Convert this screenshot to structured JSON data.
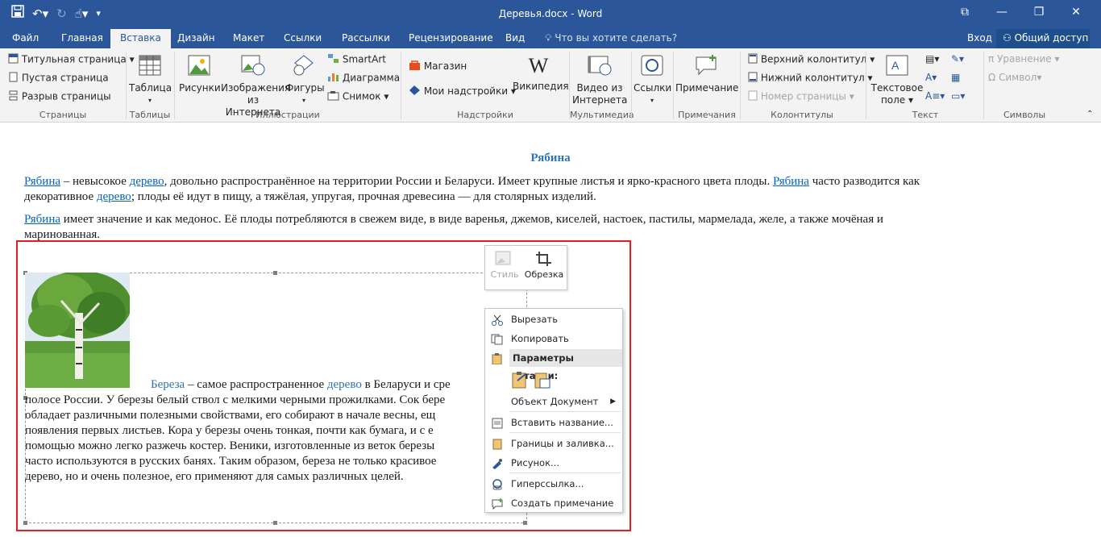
{
  "window": {
    "title": "Деревья.docx - Word",
    "controls": [
      "⧉",
      "—",
      "❐",
      "✕"
    ]
  },
  "tabs": {
    "file": "Файл",
    "home": "Главная",
    "insert": "Вставка",
    "design": "Дизайн",
    "layout": "Макет",
    "references": "Ссылки",
    "mailings": "Рассылки",
    "review": "Рецензирование",
    "view": "Вид",
    "tell_me": "Что вы хотите сделать?",
    "login": "Вход",
    "share": "Общий доступ"
  },
  "ribbon": {
    "pages": {
      "cover": "Титульная страница",
      "blank": "Пустая страница",
      "break": "Разрыв страницы",
      "label": "Страницы"
    },
    "tables": {
      "table": "Таблица",
      "label": "Таблицы"
    },
    "illustrations": {
      "pictures": "Рисунки",
      "online1": "Изображения",
      "online2": "из Интернета",
      "shapes": "Фигуры",
      "smartart": "SmartArt",
      "chart": "Диаграмма",
      "screenshot": "Снимок",
      "label": "Иллюстрации"
    },
    "addins": {
      "store": "Магазин",
      "my": "Мои надстройки",
      "wiki": "Википедия",
      "label": "Надстройки"
    },
    "media": {
      "video1": "Видео из",
      "video2": "Интернета",
      "label": "Мультимедиа"
    },
    "links": {
      "links": "Ссылки"
    },
    "comments": {
      "comment": "Примечание",
      "label": "Примечания"
    },
    "headerfooter": {
      "header": "Верхний колонтитул",
      "footer": "Нижний колонтитул",
      "pagenum": "Номер страницы",
      "label": "Колонтитулы"
    },
    "text": {
      "textbox1": "Текстовое",
      "textbox2": "поле",
      "label": "Текст"
    },
    "symbols": {
      "equation": "Уравнение",
      "symbol": "Символ",
      "label": "Символы"
    }
  },
  "document": {
    "heading": "Рябина",
    "p1": {
      "w1": "Рябина",
      "t1": " – невысокое ",
      "w2": "дерево",
      "t2": ", довольно распространённое на территории России и Беларуси. Имеет крупные листья и ярко-красного цвета плоды. ",
      "w3": "Рябина",
      "t3": " часто разводится как",
      "l2a": "декоративное ",
      "w4": "дерево",
      "t4": "; плоды её идут в пищу, а тяжёлая, упругая, прочная древесина — для столярных изделий."
    },
    "p2": {
      "w1": "Рябина",
      "t1": " имеет значение и как медонос. Её плоды потребляются в свежем виде, в виде варенья, джемов, киселей, настоек, пастилы, мармелада, желе, а также мочёная и",
      "t2": "маринованная."
    },
    "p3": {
      "w1": "Береза",
      "t1": " – самое распространенное ",
      "w2": "дерево",
      "t2": " в Беларуси и сре",
      "l2": "полосе России. У березы белый ствол с мелкими черными прожилками. Сок бере",
      "l3": "обладает различными полезными свойствами, его собирают в начале весны, ещ",
      "l4": "появления первых листьев. Кора у березы очень тонкая, почти как бумага, и с е",
      "l5": "помощью можно легко разжечь костер.  Веники, изготовленные из веток березы",
      "l6": "часто используются в русских банях. Таким образом, береза не только красивое",
      "l7": "дерево, но и очень полезное, его применяют для самых различных целей."
    }
  },
  "mini_toolbar": {
    "style": "Стиль",
    "crop": "Обрезка"
  },
  "context_menu": {
    "cut": "Вырезать",
    "copy": "Копировать",
    "paste_header": "Параметры вставки:",
    "object": "Объект Документ",
    "caption": "Вставить название...",
    "borders": "Границы и заливка...",
    "picture": "Рисунок...",
    "hyperlink": "Гиперссылка...",
    "comment": "Создать примечание"
  }
}
